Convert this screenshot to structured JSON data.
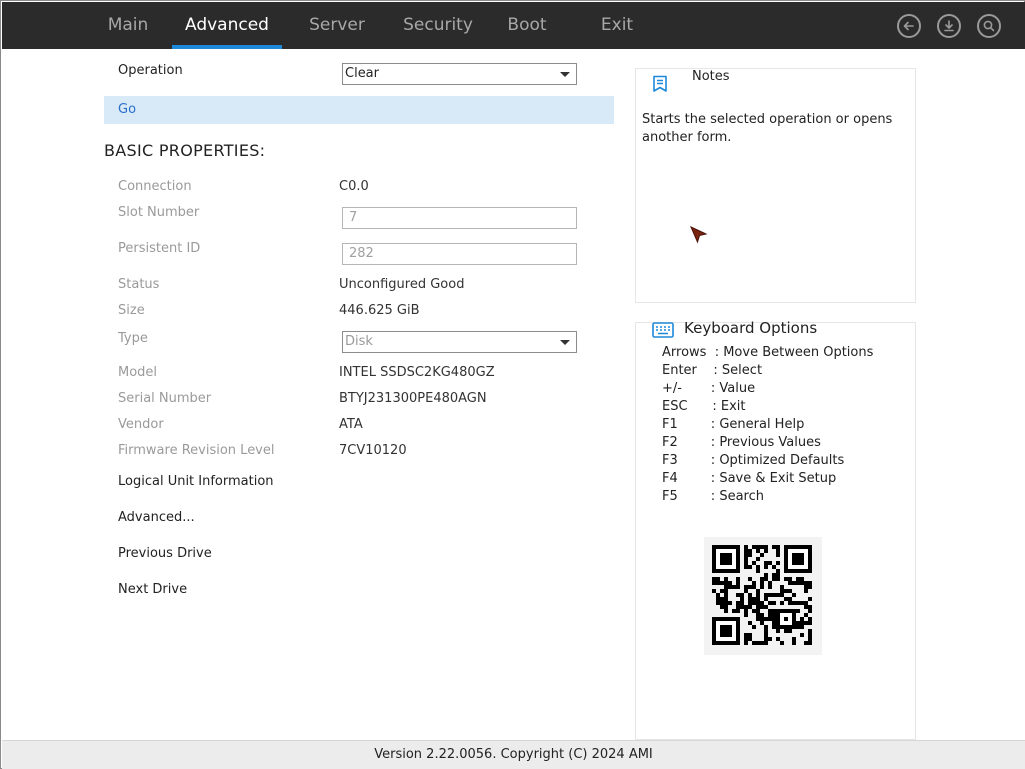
{
  "tabs": [
    {
      "label": "Main"
    },
    {
      "label": "Advanced"
    },
    {
      "label": "Server"
    },
    {
      "label": "Security"
    },
    {
      "label": "Boot"
    },
    {
      "label": "Exit"
    }
  ],
  "active_tab": "Advanced",
  "toolbar_icons": [
    "back-icon",
    "download-icon",
    "search-icon"
  ],
  "operation": {
    "label": "Operation",
    "value": "Clear"
  },
  "go_label": "Go",
  "section_title": "BASIC PROPERTIES:",
  "properties": {
    "connection": {
      "label": "Connection",
      "value": "C0.0"
    },
    "slot_number": {
      "label": "Slot Number",
      "value": "7"
    },
    "persistent_id": {
      "label": "Persistent ID",
      "value": "282"
    },
    "status": {
      "label": "Status",
      "value": "Unconfigured Good"
    },
    "size": {
      "label": "Size",
      "value": "446.625 GiB"
    },
    "type": {
      "label": "Type",
      "value": "Disk"
    },
    "model": {
      "label": "Model",
      "value": "INTEL SSDSC2KG480GZ"
    },
    "serial": {
      "label": "Serial Number",
      "value": "BTYJ231300PE480AGN"
    },
    "vendor": {
      "label": "Vendor",
      "value": "ATA"
    },
    "firmware": {
      "label": "Firmware Revision Level",
      "value": "7CV10120"
    }
  },
  "links": {
    "logical_unit": "Logical Unit Information",
    "advanced": "Advanced...",
    "previous": "Previous Drive",
    "next": "Next Drive"
  },
  "notes": {
    "title": "Notes",
    "text": "Starts the selected operation or opens another form."
  },
  "keyboard": {
    "title": "Keyboard Options",
    "lines": [
      "Arrows  : Move Between Options",
      "Enter    : Select",
      "+/-       : Value",
      "ESC      : Exit",
      "F1        : General Help",
      "F2        : Previous Values",
      "F3        : Optimized Defaults",
      "F4        : Save & Exit Setup",
      "F5        : Search"
    ]
  },
  "footer": "Version 2.22.0056. Copyright (C) 2024 AMI",
  "colors": {
    "accent": "#1e88d8",
    "topbar": "#2b2b2b",
    "go_highlight": "#d8eaf8",
    "link_blue": "#2a6fc9"
  }
}
